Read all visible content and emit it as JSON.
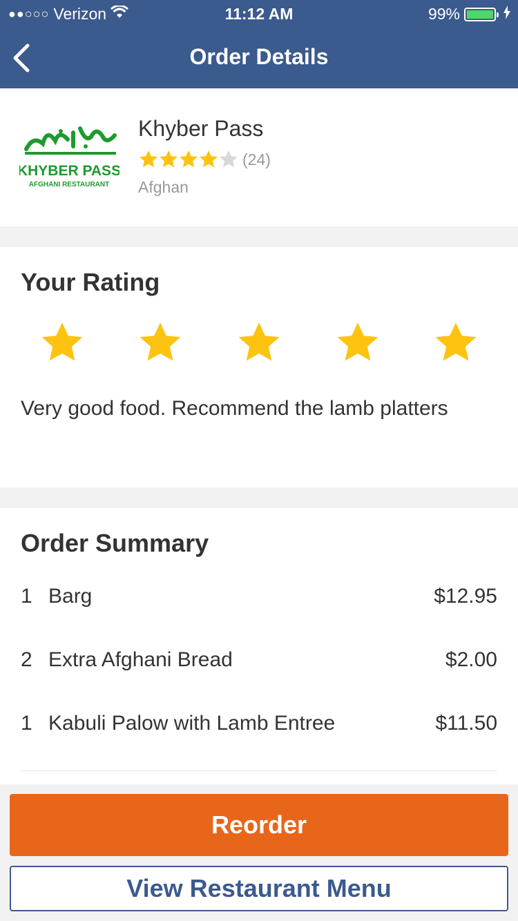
{
  "status_bar": {
    "signal_dots": "●●○○○",
    "carrier": "Verizon",
    "time": "11:12 AM",
    "battery_percent": "99%",
    "battery_level": 0.99
  },
  "nav": {
    "title": "Order Details",
    "back_icon": "chevron-left-icon"
  },
  "restaurant": {
    "name": "Khyber Pass",
    "rating": 4,
    "rating_max": 5,
    "review_count": "(24)",
    "cuisine": "Afghan",
    "logo_text": "KHYBER PASS",
    "logo_subtext": "AFGHANI RESTAURANT",
    "logo_color": "#1f9a2e"
  },
  "your_rating": {
    "title": "Your Rating",
    "stars": 5,
    "review_text": "Very good food. Recommend the lamb platters"
  },
  "order_summary": {
    "title": "Order Summary",
    "items": [
      {
        "qty": "1",
        "name": "Barg",
        "price": "$12.95"
      },
      {
        "qty": "2",
        "name": "Extra Afghani Bread",
        "price": "$2.00"
      },
      {
        "qty": "1",
        "name": "Kabuli Palow with Lamb Entree",
        "price": "$11.50"
      }
    ]
  },
  "actions": {
    "reorder_label": "Reorder",
    "view_menu_label": "View Restaurant Menu"
  },
  "colors": {
    "nav_bg": "#3b5a8d",
    "star_gold": "#fec311",
    "star_empty": "#d8d8d8",
    "reorder_bg": "#e8661a"
  }
}
